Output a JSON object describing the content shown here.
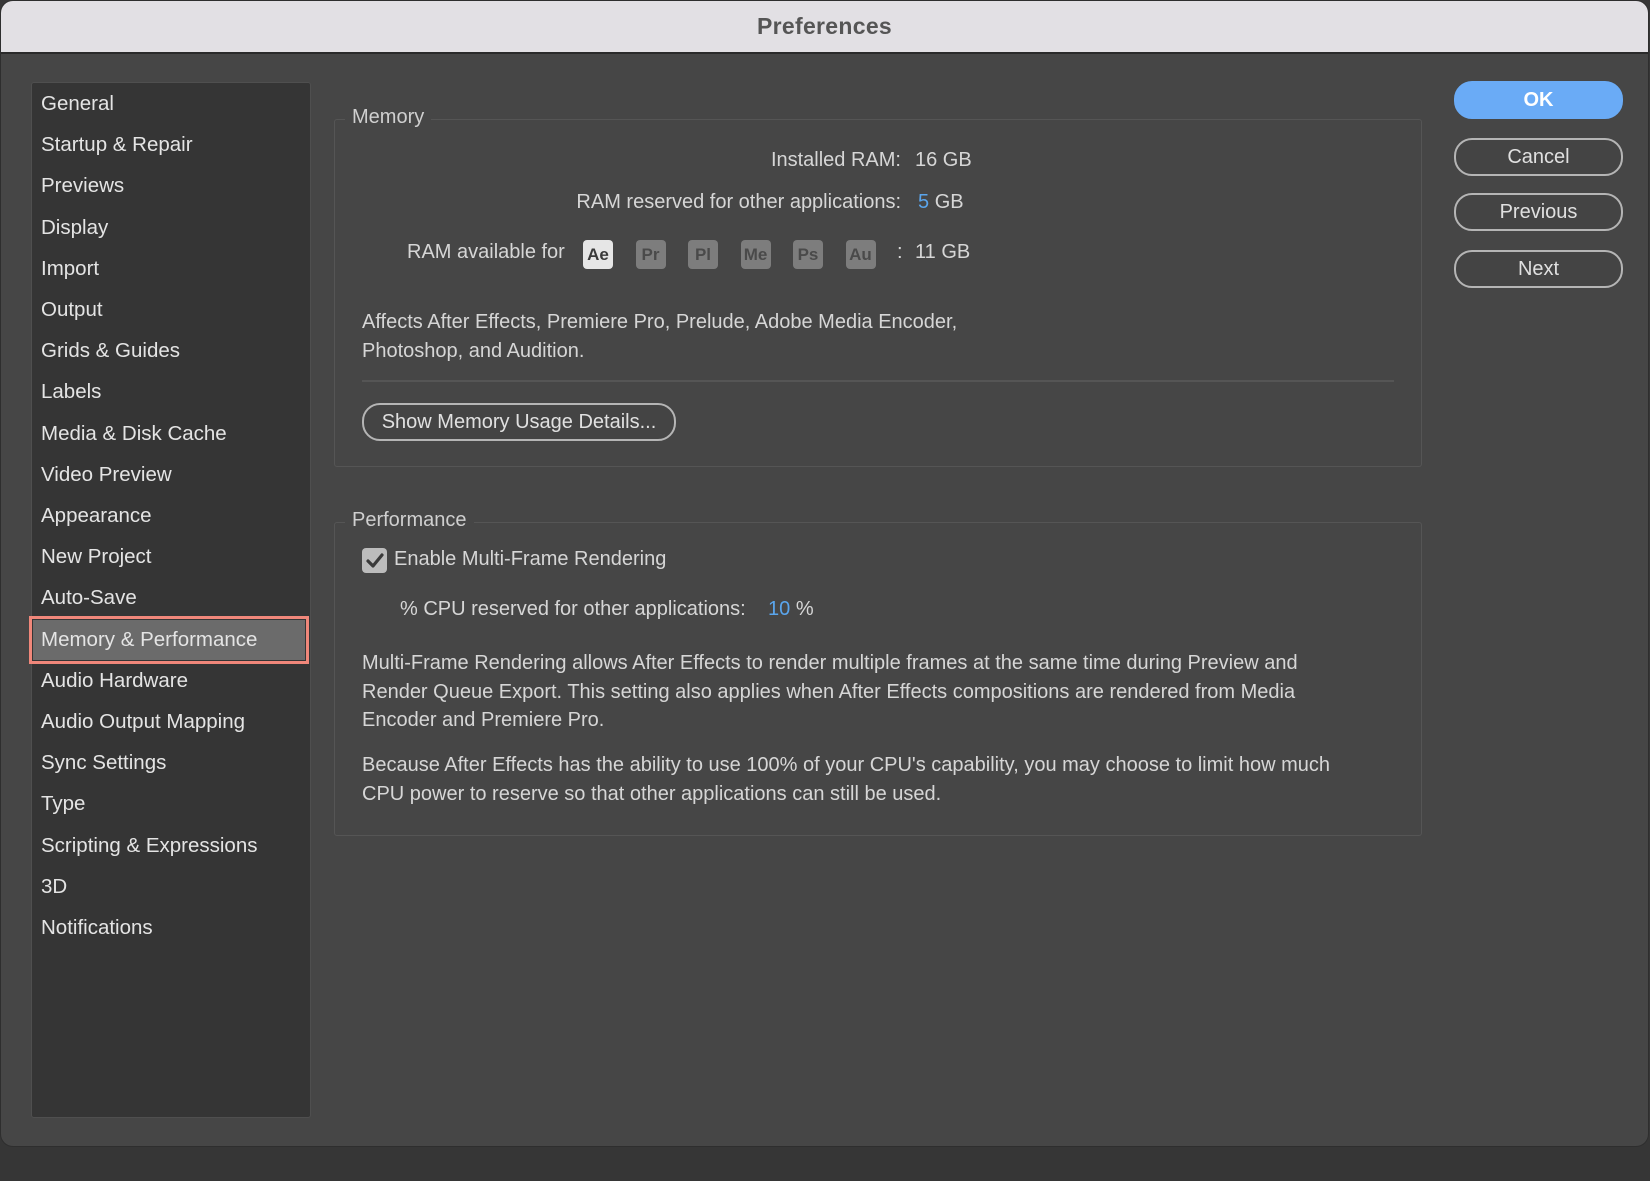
{
  "window": {
    "title": "Preferences"
  },
  "sidebar": {
    "items": [
      {
        "label": "General"
      },
      {
        "label": "Startup & Repair"
      },
      {
        "label": "Previews"
      },
      {
        "label": "Display"
      },
      {
        "label": "Import"
      },
      {
        "label": "Output"
      },
      {
        "label": "Grids & Guides"
      },
      {
        "label": "Labels"
      },
      {
        "label": "Media & Disk Cache"
      },
      {
        "label": "Video Preview"
      },
      {
        "label": "Appearance"
      },
      {
        "label": "New Project"
      },
      {
        "label": "Auto-Save"
      },
      {
        "label": "Memory & Performance",
        "selected": true
      },
      {
        "label": "Audio Hardware"
      },
      {
        "label": "Audio Output Mapping"
      },
      {
        "label": "Sync Settings"
      },
      {
        "label": "Type"
      },
      {
        "label": "Scripting & Expressions"
      },
      {
        "label": "3D"
      },
      {
        "label": "Notifications"
      }
    ],
    "highlight_color": "#f0877a"
  },
  "memory": {
    "title": "Memory",
    "installed_label": "Installed RAM:",
    "installed_value": "16 GB",
    "reserved_label": "RAM reserved for other applications:",
    "reserved_value": "5",
    "reserved_unit": "GB",
    "available_label": "RAM available for",
    "apps": [
      {
        "abbr": "Ae",
        "active": true
      },
      {
        "abbr": "Pr",
        "active": false
      },
      {
        "abbr": "Pl",
        "active": false
      },
      {
        "abbr": "Me",
        "active": false
      },
      {
        "abbr": "Ps",
        "active": false
      },
      {
        "abbr": "Au",
        "active": false
      }
    ],
    "available_sep": ":",
    "available_value": "11 GB",
    "affects_line1": "Affects After Effects, Premiere Pro, Prelude, Adobe Media Encoder,",
    "affects_line2": "Photoshop, and Audition.",
    "details_button": "Show Memory Usage Details..."
  },
  "performance": {
    "title": "Performance",
    "mfr_checkbox_label": "Enable Multi-Frame Rendering",
    "mfr_checked": true,
    "cpu_label": "% CPU reserved for other applications:",
    "cpu_value": "10",
    "cpu_unit": "%",
    "desc1_line1": "Multi-Frame Rendering allows After Effects to render multiple frames at the same time during Preview and",
    "desc1_line2": "Render Queue Export. This setting also applies when After Effects compositions are rendered from Media",
    "desc1_line3": "Encoder and Premiere Pro.",
    "desc2_line1": "Because After Effects has the ability to use 100% of your CPU's capability, you may choose to limit how much",
    "desc2_line2": "CPU power to reserve so that other applications can still be used."
  },
  "buttons": {
    "ok": "OK",
    "cancel": "Cancel",
    "previous": "Previous",
    "next": "Next"
  },
  "colors": {
    "accent": "#5aa5ec",
    "ok_button": "#6aabf6",
    "background": "#464646",
    "sidebar": "#353535"
  }
}
